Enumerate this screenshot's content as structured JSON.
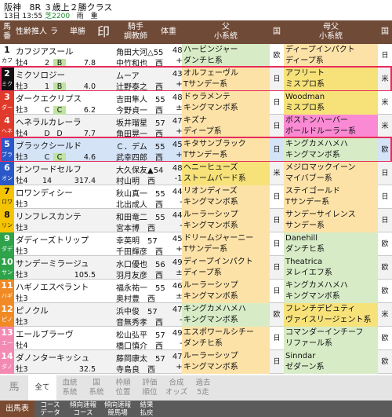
{
  "header": {
    "venue": "阪神",
    "race": "8R",
    "race_name": "３歳上２勝クラス",
    "day": "13日",
    "time": "13:55",
    "course": "芝2200",
    "condition": "雨　重"
  },
  "columns": [
    "馬番",
    "性齢",
    "推人",
    "ラ",
    "単勝",
    "印",
    "騎手\n調教師",
    "体重",
    "父\n小系統",
    "国",
    "母父\n小系統",
    "国"
  ],
  "horses": [
    {
      "no": "1",
      "kana": "カフジ",
      "name": "カフジアスール",
      "sex": "牡4",
      "ninki": "2",
      "rank": "B",
      "odds": "7.8",
      "jockey": "角田大河△55",
      "trainer": "中竹和也　西",
      "weight": "484",
      "diff": "+4",
      "sire1": "ハービンジャー",
      "sire2": "ダンチヒ系",
      "sire_c": "欧",
      "dam1": "ディープインパクト",
      "dam2": "ディープ系",
      "dam_c": "日",
      "waku": "#ffffff",
      "wtext": "#111",
      "sire_bg": "c-eur",
      "dam_bg": "c-sun"
    },
    {
      "no": "2",
      "kana": "ミクソ",
      "name": "ミクソロジー",
      "sex": "牡3",
      "ninki": "1",
      "rank": "B",
      "odds": "4.0",
      "jockey": "ムーア",
      "trainer": "辻野泰之　西",
      "weight": "434",
      "diff": "+4",
      "sire1": "オルフェーヴル",
      "sire2": "Tサンデー系",
      "sire_c": "日",
      "dam1": "アフリート",
      "dam2": "ミスプロ系",
      "dam_c": "米",
      "waku": "#111111",
      "wtext": "#fff",
      "sire_bg": "c-sun",
      "dam_bg": "c-usa"
    },
    {
      "no": "3",
      "kana": "ダーク",
      "name": "ダークエクリプス",
      "sex": "牡3",
      "ninki": "C",
      "rank": "C",
      "odds": "6.2",
      "jockey": "吉田隼人　55",
      "trainer": "今野貞一　西",
      "weight": "480",
      "diff": "±0",
      "sire1": "ドゥラメンテ",
      "sire2": "キングマンボ系",
      "sire_c": "日",
      "dam1": "Woodman",
      "dam2": "ミスプロ系",
      "dam_c": "米",
      "waku": "#e03a2a",
      "wtext": "#fff",
      "sire_bg": "c-sun",
      "dam_bg": "c-usa"
    },
    {
      "no": "4",
      "kana": "ヘネラ",
      "name": "ヘネラルカレーラ",
      "sex": "牡4",
      "ninki": "D",
      "rank": "D",
      "odds": "7.7",
      "jockey": "坂井瑠星　57",
      "trainer": "角田晃一　西",
      "weight": "474",
      "diff": "+6",
      "sire1": "キズナ",
      "sire2": "ディープ系",
      "sire_c": "日",
      "dam1": "ボストンハーバー",
      "dam2": "ボールドルーラー系",
      "dam_c": "米",
      "waku": "#e03a2a",
      "wtext": "#fff",
      "sire_bg": "c-sun",
      "dam_bg": "c-pk"
    },
    {
      "no": "5",
      "kana": "ブラッ",
      "name": "ブラックシールド",
      "sex": "牡3",
      "ninki": "C",
      "rank": "C",
      "odds": "4.6",
      "jockey": "Ｃ．デム　55",
      "trainer": "武幸四郎　西",
      "weight": "458",
      "diff": "+2",
      "sire1": "キタサンブラック",
      "sire2": "Tサンデー系",
      "sire_c": "日",
      "dam1": "キングカメハメハ",
      "dam2": "キングマンボ系",
      "dam_c": "欧",
      "waku": "#2a58c8",
      "wtext": "#fff",
      "sire_bg": "c-sun",
      "dam_bg": "c-eur"
    },
    {
      "no": "6",
      "kana": "オンワ",
      "name": "オンワードセルフ",
      "sex": "牡4",
      "ninki": "14",
      "rank": "",
      "odds": "317.4",
      "jockey": "大久保友▲54",
      "trainer": "村山明　西",
      "weight": "482",
      "diff": "-14",
      "sire1": "ヘニーヒューズ",
      "sire2": "ストームバード系",
      "sire_c": "米",
      "dam1": "メジロマックイーン",
      "dam2": "マイバブー系",
      "dam_c": "日",
      "waku": "#2a58c8",
      "wtext": "#fff",
      "sire_bg": "c-usa",
      "dam_bg": "c-sun"
    },
    {
      "no": "7",
      "kana": "ロワン",
      "name": "ロワンディシー",
      "sex": "牡3",
      "ninki": "",
      "rank": "",
      "odds": "",
      "jockey": "秋山真一　55",
      "trainer": "北出成人　西",
      "weight": "444",
      "diff": "-6",
      "sire1": "リオンディーズ",
      "sire2": "キングマンボ系",
      "sire_c": "日",
      "dam1": "ステイゴールド",
      "dam2": "Tサンデー系",
      "dam_c": "日",
      "waku": "#f5c400",
      "wtext": "#111",
      "sire_bg": "c-sun",
      "dam_bg": "c-sun"
    },
    {
      "no": "8",
      "kana": "リンフ",
      "name": "リンフレスカンテ",
      "sex": "牡3",
      "ninki": "",
      "rank": "",
      "odds": "",
      "jockey": "和田竜二　55",
      "trainer": "宮本博　西",
      "weight": "440",
      "diff": "-6",
      "sire1": "ルーラーシップ",
      "sire2": "キングマンボ系",
      "sire_c": "日",
      "dam1": "サンデーサイレンス",
      "dam2": "サンデー系",
      "dam_c": "日",
      "waku": "#f5c400",
      "wtext": "#111",
      "sire_bg": "c-sun",
      "dam_bg": "c-sun"
    },
    {
      "no": "9",
      "kana": "ダディ",
      "name": "ダディーズトリップ",
      "sex": "牡3",
      "ninki": "",
      "rank": "",
      "odds": "",
      "jockey": "幸英明　57",
      "trainer": "千田輝彦　西",
      "weight": "450",
      "diff": "+6",
      "sire1": "ドリームジャーニー",
      "sire2": "Tサンデー系",
      "sire_c": "日",
      "dam1": "Danehill",
      "dam2": "ダンチヒ系",
      "dam_c": "欧",
      "waku": "#2ea34a",
      "wtext": "#fff",
      "sire_bg": "c-sun",
      "dam_bg": "c-eur"
    },
    {
      "no": "10",
      "kana": "サンデ",
      "name": "サンデーミラージュ",
      "sex": "牡3",
      "ninki": "",
      "rank": "",
      "odds": "105.5",
      "jockey": "水口優也　56",
      "trainer": "羽月友彦　西",
      "weight": "496",
      "diff": "±0",
      "sire1": "ディープインパクト",
      "sire2": "ディープ系",
      "sire_c": "日",
      "dam1": "Theatrica",
      "dam2": "ヌレイエフ系",
      "dam_c": "欧",
      "waku": "#2ea34a",
      "wtext": "#fff",
      "sire_bg": "c-sun",
      "dam_bg": "c-eur"
    },
    {
      "no": "11",
      "kana": "ハギノ",
      "name": "ハギノエスペラント",
      "sex": "牡3",
      "ninki": "",
      "rank": "",
      "odds": "",
      "jockey": "福永祐一　55",
      "trainer": "奥村豊　西",
      "weight": "462",
      "diff": "±0",
      "sire1": "ルーラーシップ",
      "sire2": "キングマンボ系",
      "sire_c": "日",
      "dam1": "キングカメハメハ",
      "dam2": "キングマンボ系",
      "dam_c": "欧",
      "waku": "#f08a24",
      "wtext": "#fff",
      "sire_bg": "c-sun",
      "dam_bg": "c-eur"
    },
    {
      "no": "12",
      "kana": "ピノク",
      "name": "ピノクル",
      "sex": "牡3",
      "ninki": "",
      "rank": "",
      "odds": "",
      "jockey": "浜中俊　57",
      "trainer": "音無秀孝　西",
      "weight": "478",
      "diff": "-4",
      "sire1": "キングカメハメハ",
      "sire2": "キングマンボ系",
      "sire_c": "欧",
      "dam1": "フレンチデピュティ",
      "dam2": "ヴァイスリージェント系",
      "dam_c": "米",
      "waku": "#f08a24",
      "wtext": "#fff",
      "sire_bg": "c-eur",
      "dam_bg": "c-usa"
    },
    {
      "no": "13",
      "kana": "エール",
      "name": "エールブラーヴ",
      "sex": "牡4",
      "ninki": "",
      "rank": "",
      "odds": "",
      "jockey": "松山弘平　57",
      "trainer": "橋口慎介　西",
      "weight": "496",
      "diff": "-6",
      "sire1": "エスポワールシチー",
      "sire2": "ダンチヒ系",
      "sire_c": "日",
      "dam1": "コマンダーインチーフ",
      "dam2": "リファール系",
      "dam_c": "欧",
      "waku": "#f38ab3",
      "wtext": "#fff",
      "sire_bg": "c-sun",
      "dam_bg": "c-eur"
    },
    {
      "no": "14",
      "kana": "ダノン",
      "name": "ダノンターキッシュ",
      "sex": "牡3",
      "ninki": "",
      "rank": "",
      "odds": "32.5",
      "jockey": "藤岡康太　57",
      "trainer": "寺島良　西",
      "weight": "478",
      "diff": "+4",
      "sire1": "ルーラーシップ",
      "sire2": "キングマンボ系",
      "sire_c": "日",
      "dam1": "Sinndar",
      "dam2": "ゼダーン系",
      "dam_c": "欧",
      "waku": "#f38ab3",
      "wtext": "#fff",
      "sire_bg": "c-sun",
      "dam_bg": "c-eur"
    }
  ],
  "nav": [
    "馬",
    "全て",
    "血統\n系統",
    "国\n系統",
    "枠順\n位置",
    "評価\n順位",
    "合成\nオッズ",
    "過去\n5走"
  ],
  "tabs": [
    "出馬表",
    "コース\nデータ",
    "傾向速報\nコース",
    "傾向速報\n競馬場",
    "結果\n払戻"
  ]
}
